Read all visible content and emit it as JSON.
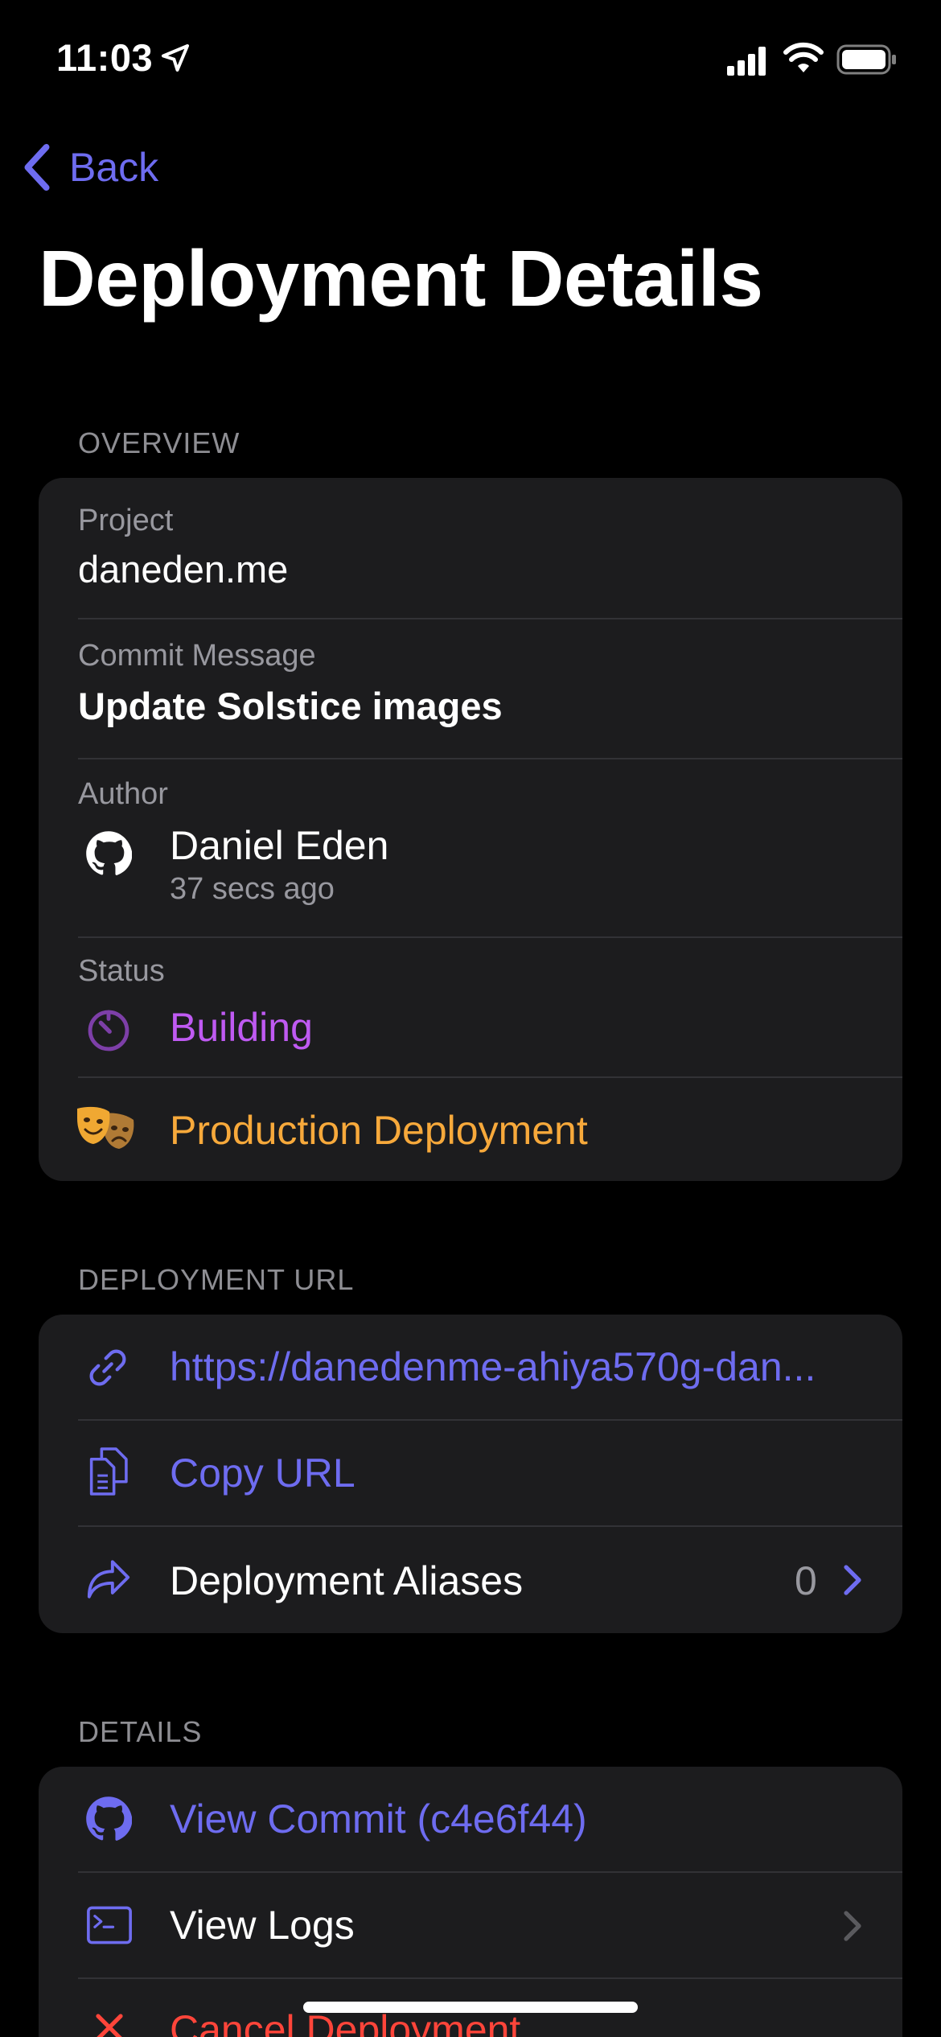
{
  "status_bar": {
    "time": "11:03"
  },
  "nav": {
    "back_label": "Back",
    "title": "Deployment Details"
  },
  "overview": {
    "header": "OVERVIEW",
    "project_label": "Project",
    "project_value": "daneden.me",
    "commit_label": "Commit Message",
    "commit_value": "Update Solstice images",
    "author_label": "Author",
    "author_name": "Daniel Eden",
    "author_time": "37 secs ago",
    "status_label": "Status",
    "status_value": "Building",
    "target_value": "Production Deployment"
  },
  "deployment_url": {
    "header": "DEPLOYMENT URL",
    "url": "https://danedenme-ahiya570g-dan...",
    "copy_label": "Copy URL",
    "aliases_label": "Deployment Aliases",
    "aliases_count": "0"
  },
  "details": {
    "header": "DETAILS",
    "view_commit": "View Commit (c4e6f44)",
    "view_logs": "View Logs",
    "cancel": "Cancel Deployment"
  },
  "colors": {
    "accent": "#6e6cf0",
    "building": "#bf5af2",
    "production": "#f7a93b",
    "danger": "#ff453a",
    "card": "#1c1c1e"
  }
}
